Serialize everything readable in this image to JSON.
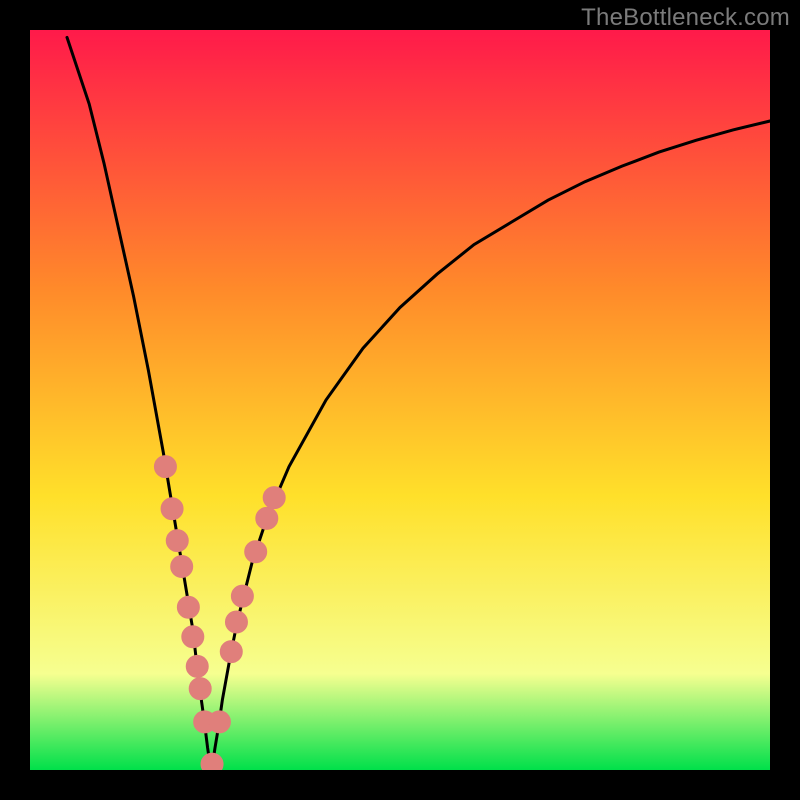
{
  "watermark": "TheBottleneck.com",
  "colors": {
    "frame": "#000000",
    "curve": "#000000",
    "marker_fill": "#e07f7b",
    "marker_stroke": "#e07f7b",
    "gradient_top": "#ff1a4a",
    "gradient_mid1": "#ff8a2a",
    "gradient_mid2": "#ffe02a",
    "gradient_low": "#f6ff90",
    "gradient_bottom": "#00e04a"
  },
  "chart_data": {
    "type": "line",
    "title": "",
    "xlabel": "",
    "ylabel": "",
    "xlim": [
      0,
      100
    ],
    "ylim": [
      0,
      100
    ],
    "x_min_curve": 24.5,
    "series": [
      {
        "name": "bottleneck-curve",
        "x": [
          5,
          8,
          10,
          12,
          14,
          16,
          18,
          19,
          20,
          21,
          22,
          22.8,
          23.5,
          24,
          24.3,
          24.5,
          24.7,
          25,
          25.5,
          26,
          27,
          28,
          29,
          30,
          32,
          35,
          40,
          45,
          50,
          55,
          60,
          65,
          70,
          75,
          80,
          85,
          90,
          95,
          100
        ],
        "y": [
          99,
          90,
          82,
          73,
          64,
          54,
          43,
          37,
          31,
          25,
          19,
          12,
          7,
          3,
          1,
          0,
          1,
          3,
          6,
          9.5,
          15,
          20,
          24,
          28,
          34,
          41,
          50,
          57,
          62.5,
          67,
          71,
          74,
          77,
          79.5,
          81.6,
          83.5,
          85.1,
          86.5,
          87.7
        ]
      }
    ],
    "markers": [
      {
        "x": 18.3,
        "y": 41.0
      },
      {
        "x": 19.2,
        "y": 35.3
      },
      {
        "x": 19.9,
        "y": 31.0
      },
      {
        "x": 20.5,
        "y": 27.5
      },
      {
        "x": 21.4,
        "y": 22.0
      },
      {
        "x": 22.0,
        "y": 18.0
      },
      {
        "x": 22.6,
        "y": 14.0
      },
      {
        "x": 23.0,
        "y": 11.0
      },
      {
        "x": 23.6,
        "y": 6.5
      },
      {
        "x": 24.6,
        "y": 0.8
      },
      {
        "x": 25.6,
        "y": 6.5
      },
      {
        "x": 27.2,
        "y": 16.0
      },
      {
        "x": 27.9,
        "y": 20.0
      },
      {
        "x": 28.7,
        "y": 23.5
      },
      {
        "x": 30.5,
        "y": 29.5
      },
      {
        "x": 32.0,
        "y": 34.0
      },
      {
        "x": 33.0,
        "y": 36.8
      }
    ]
  }
}
